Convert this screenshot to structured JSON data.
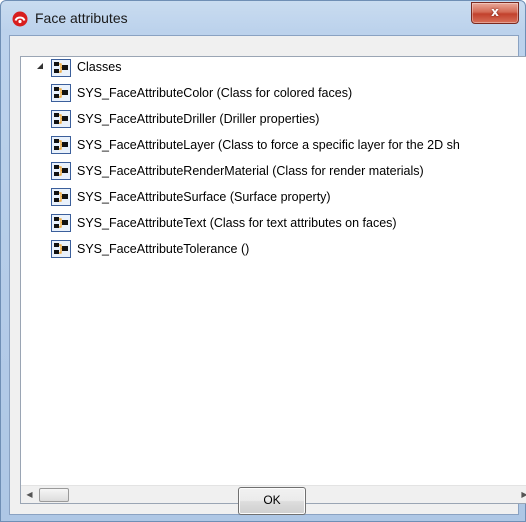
{
  "window": {
    "title": "Face attributes",
    "close_glyph": "x"
  },
  "tree": {
    "root_label": "Classes",
    "items": [
      "SYS_FaceAttributeColor (Class for colored faces)",
      "SYS_FaceAttributeDriller (Driller properties)",
      "SYS_FaceAttributeLayer (Class to force a specific layer for the 2D sh",
      "SYS_FaceAttributeRenderMaterial (Class for render materials)",
      "SYS_FaceAttributeSurface (Surface property)",
      "SYS_FaceAttributeText (Class for text attributes on faces)",
      "SYS_FaceAttributeTolerance ()"
    ]
  },
  "scrollbar": {
    "left_arrow": "◀",
    "right_arrow": "▶"
  },
  "buttons": {
    "ok_label": "OK"
  },
  "icons": {
    "app": "red-logo-icon",
    "class": "class-node-icon",
    "expander": "expanded-triangle-icon"
  },
  "colors": {
    "titlebar": "#bcd2ec",
    "close_button": "#c2412c",
    "client_background": "#f0f0f0"
  }
}
